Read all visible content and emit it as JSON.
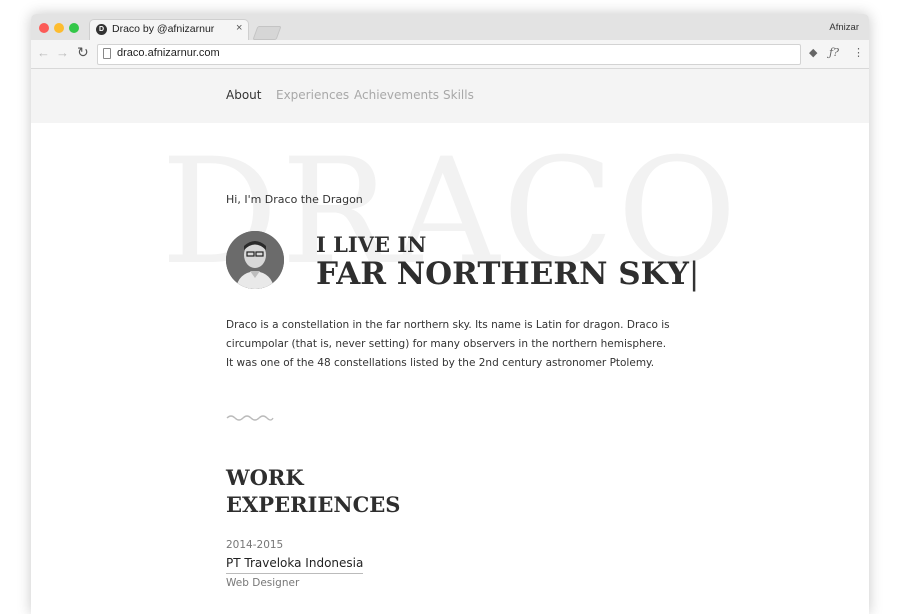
{
  "browser": {
    "tab_title": "Draco by @afnizarnur",
    "favicon_letter": "D",
    "tab_close": "×",
    "url": "draco.afnizarnur.com",
    "profile_name": "Afnizar",
    "extension_icons": [
      "layers-icon",
      "function-icon",
      "more-vert-icon"
    ],
    "extension_glyphs": [
      "◆",
      "ƒ?",
      "⋮"
    ]
  },
  "site": {
    "nav": [
      "About",
      "Experiences",
      "Achievements",
      "Skills"
    ],
    "active_nav": "About",
    "background_word": "DRACO",
    "greeting": "Hi, I'm Draco the Dragon",
    "headline_line1": "I LIVE IN",
    "headline_line2": "FAR NORTHERN SKY",
    "headline_cursor": "|",
    "bio": "Draco is a constellation in the far northern sky. Its name is Latin for dragon. Draco is circumpolar (that is, never setting) for many observers in the northern hemisphere. It was one of the 48 constellations listed by the 2nd century astronomer Ptolemy.",
    "section_title_line1": "WORK",
    "section_title_line2": "EXPERIENCES",
    "experiences": [
      {
        "years": "2014-2015",
        "company": "PT Traveloka Indonesia",
        "role": "Web Designer"
      }
    ]
  },
  "colors": {
    "accent_text": "#2e2e2e",
    "nav_inactive": "#a8a8a8",
    "nav_bg": "#f4f4f4",
    "background_word": "#f2f2f2"
  }
}
